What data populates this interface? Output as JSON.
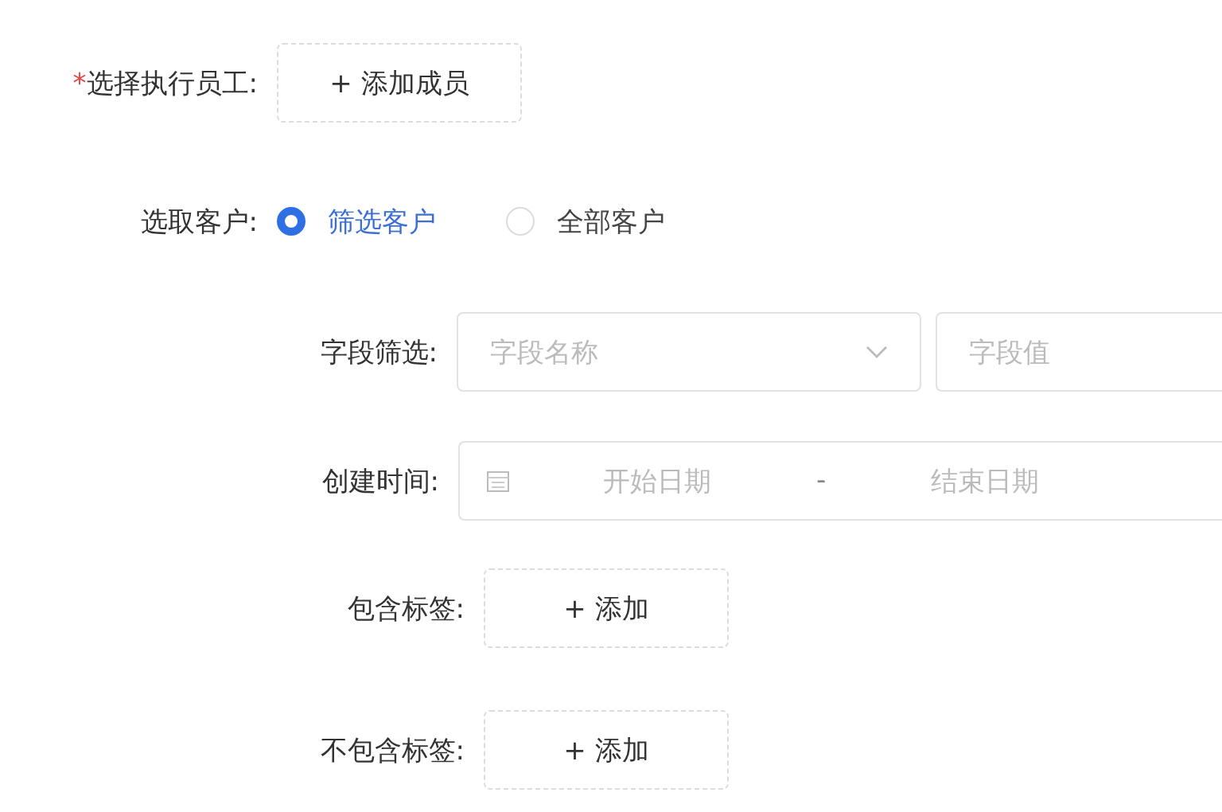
{
  "employee": {
    "required_mark": "*",
    "label": "选择执行员工:",
    "button": "+ 添加成员"
  },
  "customer": {
    "label": "选取客户:",
    "options": [
      {
        "label": "筛选客户",
        "selected": true
      },
      {
        "label": "全部客户",
        "selected": false
      }
    ]
  },
  "filters": [
    {
      "kind": "field",
      "label": "字段筛选:",
      "name_placeholder": "字段名称",
      "value_placeholder": "字段值"
    },
    {
      "kind": "daterange",
      "label": "创建时间:",
      "start_placeholder": "开始日期",
      "separator": "-",
      "end_placeholder": "结束日期"
    },
    {
      "kind": "button",
      "label": "包含标签:",
      "button": "+ 添加"
    },
    {
      "kind": "button",
      "label": "不包含标签:",
      "button": "+ 添加"
    }
  ]
}
